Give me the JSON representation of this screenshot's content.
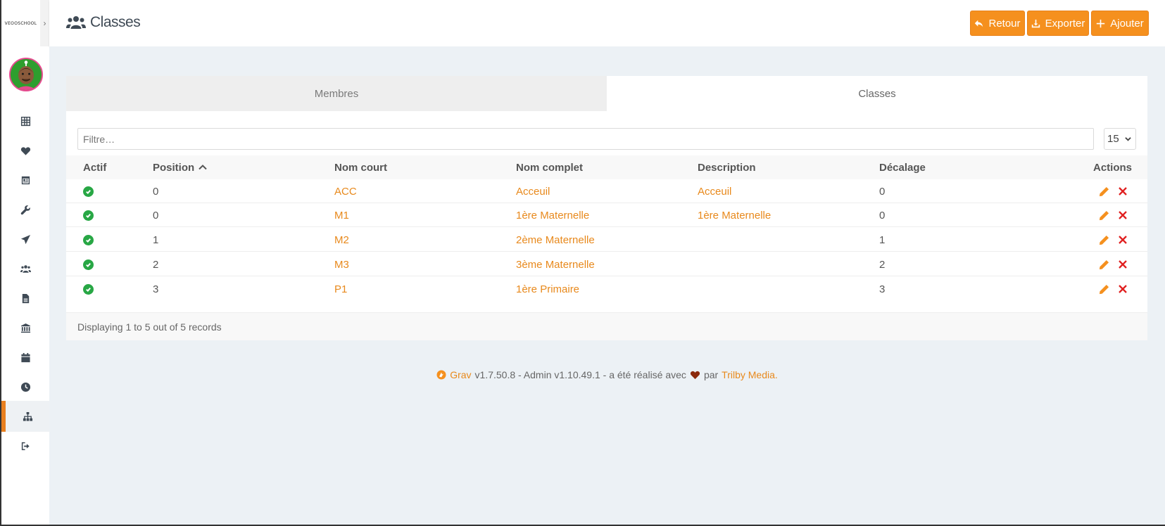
{
  "brand": {
    "logo_text": "VEOOSCHOOL"
  },
  "header": {
    "title": "Classes",
    "buttons": {
      "back": "Retour",
      "export": "Exporter",
      "add": "Ajouter"
    }
  },
  "sidebar": {
    "toggle_glyph": "›",
    "items": [
      {
        "icon": "dashboard-grid-icon"
      },
      {
        "icon": "heart-icon"
      },
      {
        "icon": "calendar-news-icon"
      },
      {
        "icon": "wrench-icon"
      },
      {
        "icon": "paper-plane-icon"
      },
      {
        "icon": "users-icon"
      },
      {
        "icon": "file-icon"
      },
      {
        "icon": "bank-icon"
      },
      {
        "icon": "calendar-icon"
      },
      {
        "icon": "clock-icon"
      },
      {
        "icon": "sitemap-icon",
        "active": true
      },
      {
        "icon": "logout-icon"
      }
    ]
  },
  "tabs": {
    "members": "Membres",
    "classes": "Classes"
  },
  "filter": {
    "placeholder": "Filtre…"
  },
  "per_page": {
    "value": "15"
  },
  "table": {
    "headers": {
      "actif": "Actif",
      "position": "Position",
      "nom_court": "Nom court",
      "nom_complet": "Nom complet",
      "description": "Description",
      "decalage": "Décalage",
      "actions": "Actions"
    },
    "rows": [
      {
        "position": "0",
        "nom_court": "ACC",
        "nom_complet": "Acceuil",
        "description": "Acceuil",
        "decalage": "0"
      },
      {
        "position": "0",
        "nom_court": "M1",
        "nom_complet": "1ère Maternelle",
        "description": "1ère Maternelle",
        "decalage": "0"
      },
      {
        "position": "1",
        "nom_court": "M2",
        "nom_complet": "2ème Maternelle",
        "description": "",
        "decalage": "1"
      },
      {
        "position": "2",
        "nom_court": "M3",
        "nom_complet": "3ème Maternelle",
        "description": "",
        "decalage": "2"
      },
      {
        "position": "3",
        "nom_court": "P1",
        "nom_complet": "1ère Primaire",
        "description": "",
        "decalage": "3"
      }
    ],
    "summary": "Displaying 1 to 5 out of 5 records"
  },
  "footer": {
    "grav_link": "Grav",
    "text_1": "v1.7.50.8 - Admin v1.10.49.1 - a été réalisé avec",
    "text_2": "par",
    "trilby_link": "Trilby Media",
    "end": "."
  },
  "colors": {
    "accent": "#f5901e",
    "link": "#e8891c",
    "active": "#28a745",
    "delete": "#e02020",
    "background": "#ecf1f5"
  }
}
